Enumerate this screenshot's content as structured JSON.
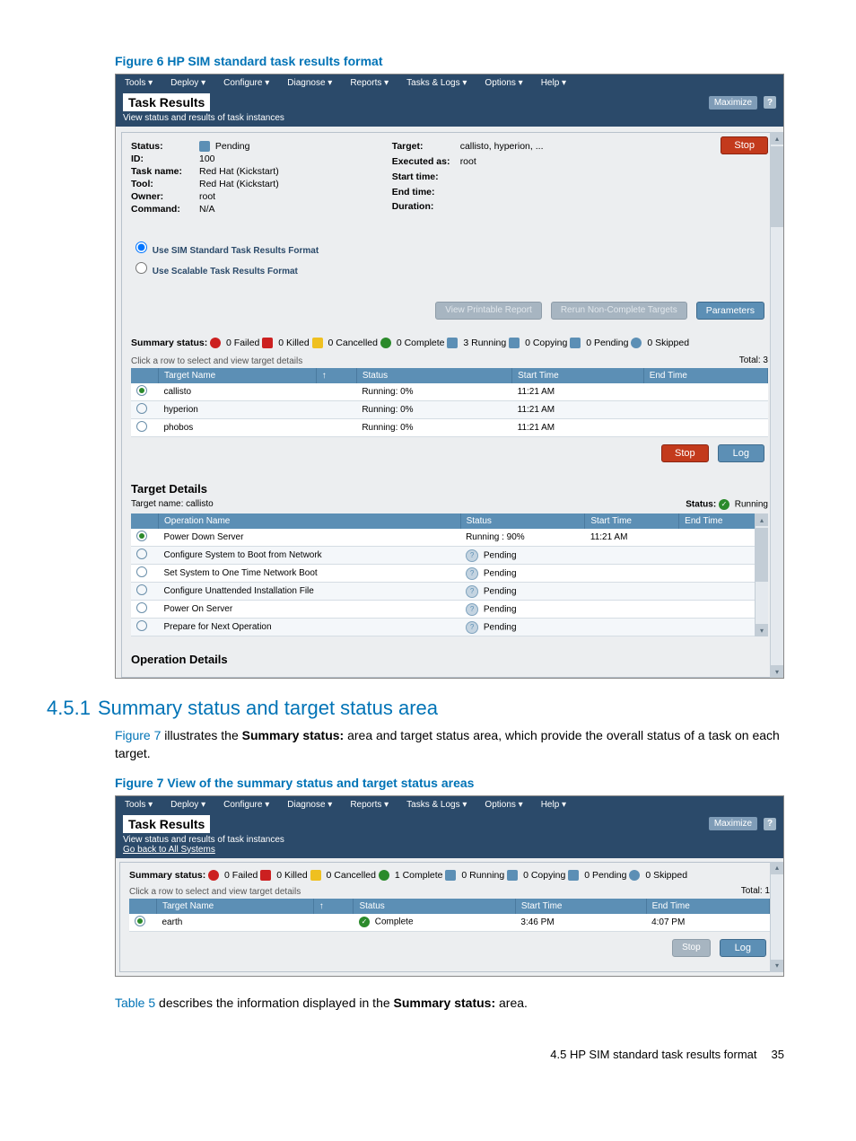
{
  "figure6": {
    "title": "Figure 6 HP SIM standard task results format",
    "menubar": [
      "Tools ▾",
      "Deploy ▾",
      "Configure ▾",
      "Diagnose ▾",
      "Reports ▾",
      "Tasks & Logs ▾",
      "Options ▾",
      "Help ▾"
    ],
    "page_title": "Task Results",
    "subtitle": "View status and results of task instances",
    "maximize": "Maximize",
    "help": "?",
    "info_left": [
      {
        "label": "Status:",
        "value": "Pending"
      },
      {
        "label": "ID:",
        "value": "100"
      },
      {
        "label": "Task name:",
        "value": "Red Hat (Kickstart)"
      },
      {
        "label": "Tool:",
        "value": "Red Hat (Kickstart)"
      },
      {
        "label": "Owner:",
        "value": "root"
      },
      {
        "label": "Command:",
        "value": "N/A"
      }
    ],
    "info_mid": [
      {
        "label": "Target:",
        "value": "callisto, hyperion, ..."
      },
      {
        "label": "Executed as:",
        "value": "root"
      },
      {
        "label": "Start time:",
        "value": ""
      },
      {
        "label": "End time:",
        "value": ""
      },
      {
        "label": "Duration:",
        "value": ""
      }
    ],
    "stop": "Stop",
    "radio": {
      "opt1": "Use SIM Standard Task Results Format",
      "opt2": "Use Scalable Task Results Format"
    },
    "buttons": {
      "view_printable": "View Printable Report",
      "rerun": "Rerun Non-Complete Targets",
      "parameters": "Parameters"
    },
    "summary": {
      "label": "Summary status:",
      "items": [
        {
          "class": "st-failed",
          "count": "0",
          "name": "Failed"
        },
        {
          "class": "st-killed",
          "count": "0",
          "name": "Killed"
        },
        {
          "class": "st-warn",
          "count": "0",
          "name": "Cancelled"
        },
        {
          "class": "st-ok",
          "count": "0",
          "name": "Complete"
        },
        {
          "class": "st-run",
          "count": "3",
          "name": "Running"
        },
        {
          "class": "st-copy",
          "count": "0",
          "name": "Copying"
        },
        {
          "class": "st-pend",
          "count": "0",
          "name": "Pending"
        },
        {
          "class": "st-skip",
          "count": "0",
          "name": "Skipped"
        }
      ]
    },
    "click_hint": "Click a row to select and view target details",
    "total": "Total: 3",
    "targets_table": {
      "headers": [
        "",
        "Target Name",
        "↑",
        "Status",
        "Start Time",
        "End Time"
      ],
      "rows": [
        {
          "sel": true,
          "name": "callisto",
          "status": "Running: 0%",
          "start": "11:21 AM",
          "end": ""
        },
        {
          "sel": false,
          "name": "hyperion",
          "status": "Running: 0%",
          "start": "11:21 AM",
          "end": ""
        },
        {
          "sel": false,
          "name": "phobos",
          "status": "Running: 0%",
          "start": "11:21 AM",
          "end": ""
        }
      ]
    },
    "log": "Log",
    "target_details": {
      "title": "Target Details",
      "subtitle": "Target name: callisto",
      "status_label": "Status:",
      "status_value": "Running",
      "headers": [
        "",
        "Operation Name",
        "Status",
        "Start Time",
        "End Time"
      ],
      "rows": [
        {
          "sel": true,
          "name": "Power Down Server",
          "status": "Running : 90%",
          "start": "11:21 AM",
          "end": ""
        },
        {
          "sel": false,
          "name": "Configure System to Boot from Network",
          "status": "Pending",
          "start": "",
          "end": ""
        },
        {
          "sel": false,
          "name": "Set System to One Time Network Boot",
          "status": "Pending",
          "start": "",
          "end": ""
        },
        {
          "sel": false,
          "name": "Configure Unattended Installation File",
          "status": "Pending",
          "start": "",
          "end": ""
        },
        {
          "sel": false,
          "name": "Power On Server",
          "status": "Pending",
          "start": "",
          "end": ""
        },
        {
          "sel": false,
          "name": "Prepare for Next Operation",
          "status": "Pending",
          "start": "",
          "end": ""
        }
      ]
    },
    "op_details": "Operation Details"
  },
  "section": {
    "num": "4.5.1",
    "title": "Summary status and target status area",
    "para_link": "Figure 7",
    "para_text_a": " illustrates the ",
    "para_bold": "Summary status:",
    "para_text_b": " area and target status area, which provide the overall status of a task on each target."
  },
  "figure7": {
    "title": "Figure 7 View of the summary status and target status areas",
    "menubar": [
      "Tools ▾",
      "Deploy ▾",
      "Configure ▾",
      "Diagnose ▾",
      "Reports ▾",
      "Tasks & Logs ▾",
      "Options ▾",
      "Help ▾"
    ],
    "page_title": "Task Results",
    "subtitle": "View status and results of task instances",
    "go_back": "Go back to All Systems",
    "maximize": "Maximize",
    "help": "?",
    "summary": {
      "label": "Summary status:",
      "items": [
        {
          "class": "st-failed",
          "count": "0",
          "name": "Failed"
        },
        {
          "class": "st-killed",
          "count": "0",
          "name": "Killed"
        },
        {
          "class": "st-warn",
          "count": "0",
          "name": "Cancelled"
        },
        {
          "class": "st-ok",
          "count": "1",
          "name": "Complete"
        },
        {
          "class": "st-run",
          "count": "0",
          "name": "Running"
        },
        {
          "class": "st-copy",
          "count": "0",
          "name": "Copying"
        },
        {
          "class": "st-pend",
          "count": "0",
          "name": "Pending"
        },
        {
          "class": "st-skip",
          "count": "0",
          "name": "Skipped"
        }
      ]
    },
    "click_hint": "Click a row to select and view target details",
    "total": "Total: 1",
    "headers": [
      "",
      "Target Name",
      "↑",
      "Status",
      "Start Time",
      "End Time"
    ],
    "rows": [
      {
        "sel": true,
        "name": "earth",
        "status": "Complete",
        "start": "3:46 PM",
        "end": "4:07 PM"
      }
    ],
    "stop": "Stop",
    "log": "Log"
  },
  "table5": {
    "link": "Table 5",
    "text_a": " describes the information displayed in the ",
    "bold": "Summary status:",
    "text_b": " area."
  },
  "footer": {
    "label": "4.5 HP SIM standard task results format",
    "page": "35"
  }
}
